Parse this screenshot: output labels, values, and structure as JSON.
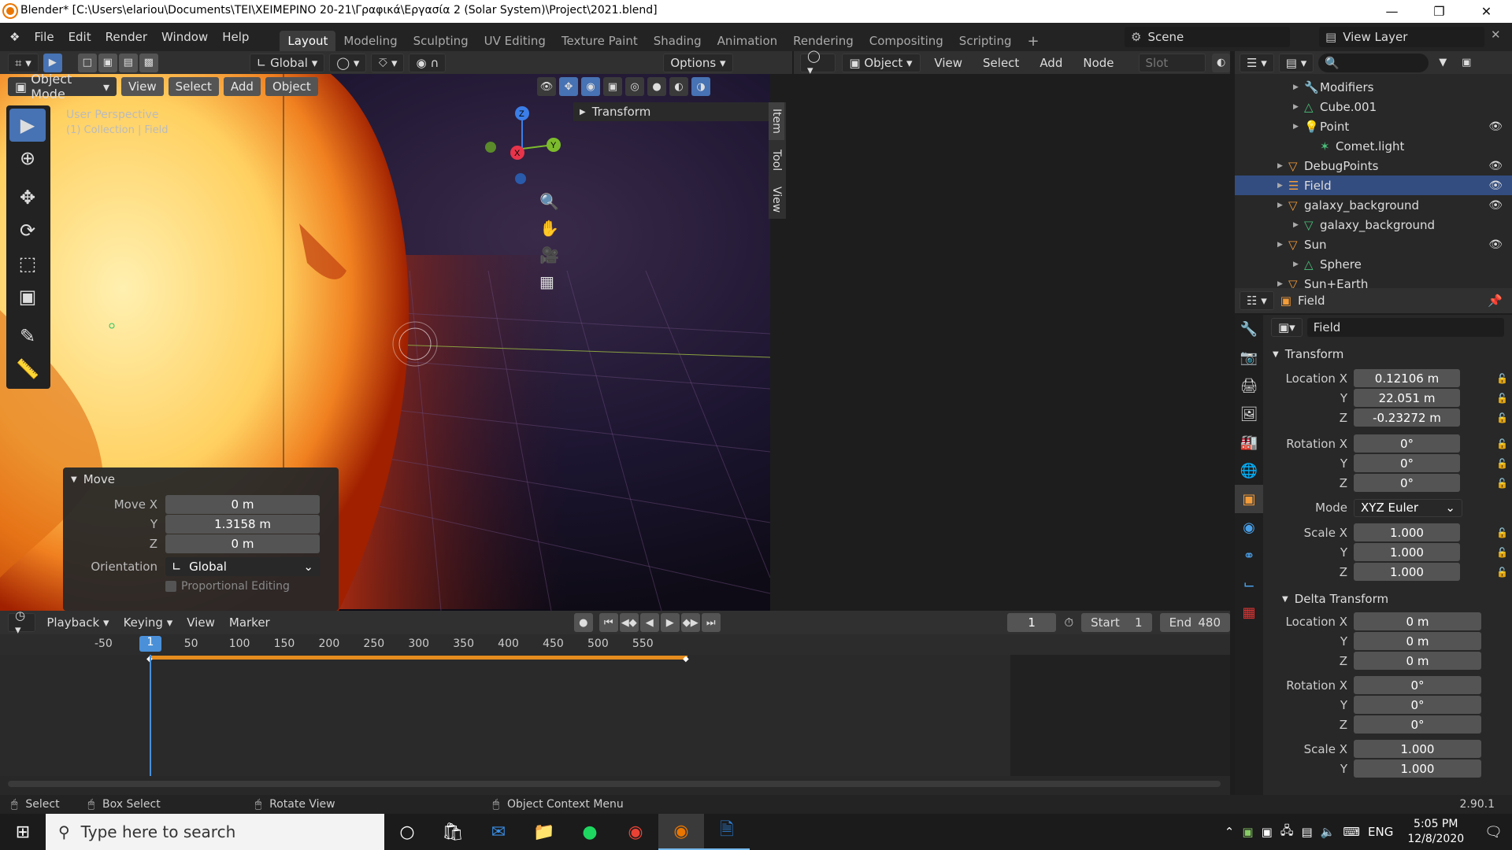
{
  "titlebar": {
    "title": "Blender* [C:\\Users\\elariou\\Documents\\TEI\\ΧΕΙΜΕΡΙΝΟ 20-21\\Γραφικά\\Εργασία 2 (Solar System)\\Project\\2021.blend]"
  },
  "menu": {
    "items": [
      "File",
      "Edit",
      "Render",
      "Window",
      "Help"
    ]
  },
  "workspaces": [
    "Layout",
    "Modeling",
    "Sculpting",
    "UV Editing",
    "Texture Paint",
    "Shading",
    "Animation",
    "Rendering",
    "Compositing",
    "Scripting"
  ],
  "scene": {
    "name": "Scene",
    "view_layer": "View Layer"
  },
  "viewport": {
    "orientation": "Global",
    "options_label": "Options",
    "mode": "Object Mode",
    "menu": [
      "View",
      "Select",
      "Add",
      "Object"
    ],
    "overlay_text": "User Perspective",
    "overlay_subtext": "(1) Collection | Field",
    "side_tabs": [
      "Item",
      "Tool",
      "View"
    ],
    "transform_panel_title": "Transform",
    "gizmo": {
      "z": "Z",
      "x": "X",
      "y": "Y"
    }
  },
  "move_panel": {
    "title": "Move",
    "fields": [
      {
        "label": "Move X",
        "value": "0 m"
      },
      {
        "label": "Y",
        "value": "1.3158 m"
      },
      {
        "label": "Z",
        "value": "0 m"
      }
    ],
    "orientation_label": "Orientation",
    "orientation_value": "Global",
    "proportional_label": "Proportional Editing"
  },
  "node_editor": {
    "object_label": "Object",
    "menu": [
      "View",
      "Select",
      "Add",
      "Node"
    ],
    "slot_label": "Slot"
  },
  "outliner": {
    "items": [
      {
        "label": "Modifiers",
        "indent": 3
      },
      {
        "label": "Cube.001",
        "indent": 3
      },
      {
        "label": "Point",
        "indent": 3
      },
      {
        "label": "Comet.light",
        "indent": 4
      },
      {
        "label": "DebugPoints",
        "indent": 2
      },
      {
        "label": "Field",
        "indent": 2
      },
      {
        "label": "galaxy_background",
        "indent": 2
      },
      {
        "label": "galaxy_background",
        "indent": 3
      },
      {
        "label": "Sun",
        "indent": 2
      },
      {
        "label": "Sphere",
        "indent": 3
      },
      {
        "label": "Sun+Earth",
        "indent": 2
      }
    ]
  },
  "properties": {
    "object_name": "Field",
    "name_field": "Field",
    "transform_title": "Transform",
    "location": [
      {
        "label": "Location X",
        "value": "0.12106 m"
      },
      {
        "label": "Y",
        "value": "22.051 m"
      },
      {
        "label": "Z",
        "value": "-0.23272 m"
      }
    ],
    "rotation": [
      {
        "label": "Rotation X",
        "value": "0°"
      },
      {
        "label": "Y",
        "value": "0°"
      },
      {
        "label": "Z",
        "value": "0°"
      }
    ],
    "mode_label": "Mode",
    "mode_value": "XYZ Euler",
    "scale": [
      {
        "label": "Scale X",
        "value": "1.000"
      },
      {
        "label": "Y",
        "value": "1.000"
      },
      {
        "label": "Z",
        "value": "1.000"
      }
    ],
    "delta_title": "Delta Transform",
    "delta_location": [
      {
        "label": "Location X",
        "value": "0 m"
      },
      {
        "label": "Y",
        "value": "0 m"
      },
      {
        "label": "Z",
        "value": "0 m"
      }
    ],
    "delta_rotation": [
      {
        "label": "Rotation X",
        "value": "0°"
      },
      {
        "label": "Y",
        "value": "0°"
      },
      {
        "label": "Z",
        "value": "0°"
      }
    ],
    "delta_scale": [
      {
        "label": "Scale X",
        "value": "1.000"
      },
      {
        "label": "Y",
        "value": "1.000"
      }
    ]
  },
  "timeline": {
    "menu": [
      "Playback",
      "Keying",
      "View",
      "Marker"
    ],
    "current_frame": "1",
    "start_label": "Start",
    "start_value": "1",
    "end_label": "End",
    "end_value": "480",
    "ruler": [
      "-50",
      "50",
      "100",
      "150",
      "200",
      "250",
      "300",
      "350",
      "400",
      "450",
      "500",
      "550"
    ],
    "frame_marker": "1"
  },
  "statusbar": {
    "select": "Select",
    "box_select": "Box Select",
    "rotate_view": "Rotate View",
    "context_menu": "Object Context Menu",
    "version": "2.90.1"
  },
  "taskbar": {
    "search_placeholder": "Type here to search",
    "lang": "ENG",
    "time": "5:05 PM",
    "date": "12/8/2020"
  },
  "colors": {
    "accent": "#4772b3",
    "selected_row": "#334d80",
    "keyframe_bar": "#e58c1e",
    "playhead": "#4a90d9"
  }
}
